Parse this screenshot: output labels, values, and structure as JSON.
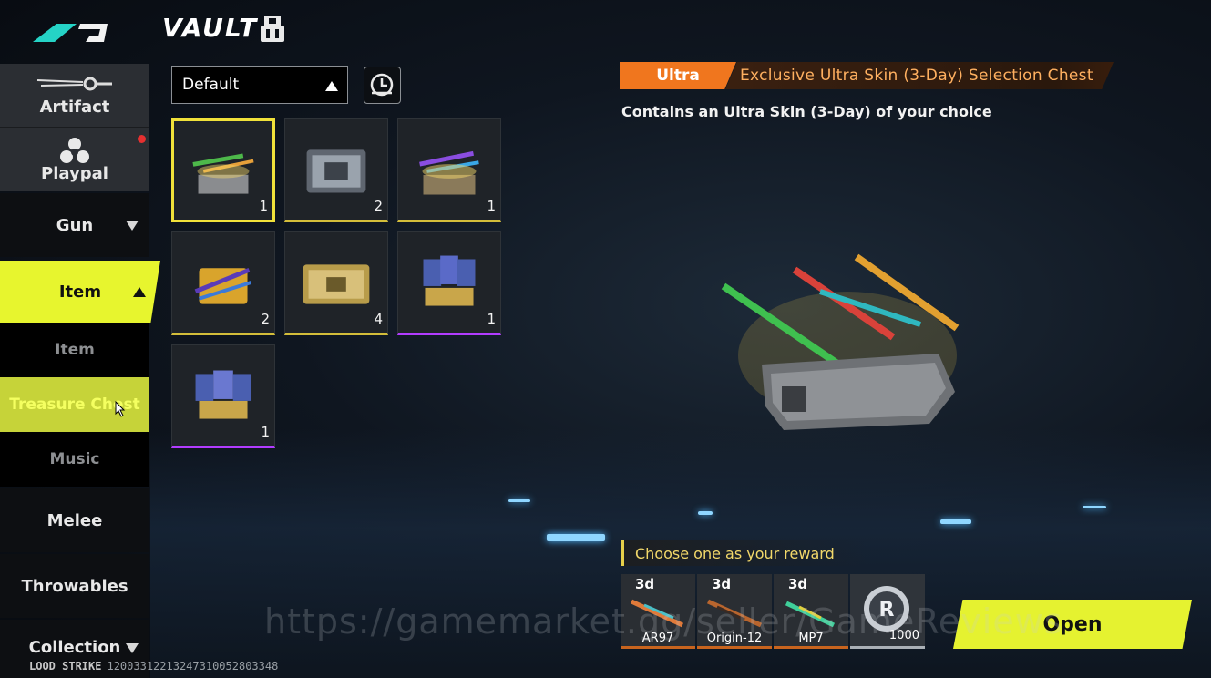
{
  "header": {
    "title": "VAULT",
    "icon": "vault-box-icon"
  },
  "sidebar": {
    "items": [
      {
        "label": "Artifact",
        "icon": "artifact-icon"
      },
      {
        "label": "Playpal",
        "icon": "playpal-icon",
        "notification": true
      },
      {
        "label": "Gun",
        "expanded": false
      },
      {
        "label": "Item",
        "expanded": true,
        "active": true
      },
      {
        "label": "Item"
      },
      {
        "label": "Treasure Chest",
        "selected": true
      },
      {
        "label": "Music"
      },
      {
        "label": "Melee"
      },
      {
        "label": "Throwables"
      },
      {
        "label": "Collection",
        "expanded": false
      }
    ]
  },
  "footer": {
    "game": "LOOD STRIKE",
    "uid": "12003312213247310052803348"
  },
  "filter": {
    "selected": "Default",
    "sort_icon": "sort-clock-icon"
  },
  "grid": {
    "cells": [
      {
        "qty": "1",
        "rarity": "gold",
        "selected": true,
        "icon": "weapon-chest-icon"
      },
      {
        "qty": "2",
        "rarity": "gold",
        "icon": "silver-crate-icon"
      },
      {
        "qty": "1",
        "rarity": "gold",
        "icon": "weapon-chest-icon"
      },
      {
        "qty": "2",
        "rarity": "gold",
        "icon": "gold-weapon-chest-icon"
      },
      {
        "qty": "4",
        "rarity": "gold",
        "icon": "gold-crate-icon"
      },
      {
        "qty": "1",
        "rarity": "purple",
        "icon": "character-card-chest-icon"
      },
      {
        "qty": "1",
        "rarity": "purple",
        "icon": "character-card-chest-icon"
      }
    ]
  },
  "detail": {
    "rarity": "Ultra",
    "title": "Exclusive Ultra Skin (3-Day) Selection Chest",
    "description": "Contains an Ultra Skin (3-Day) of your choice",
    "reward_prompt": "Choose one as your reward",
    "rewards": [
      {
        "days": "3d",
        "name": "AR97",
        "icon": "rifle-icon"
      },
      {
        "days": "3d",
        "name": "Origin-12",
        "icon": "shotgun-icon"
      },
      {
        "days": "3d",
        "name": "MP7",
        "icon": "smg-icon"
      },
      {
        "amount": "1000",
        "icon": "r-coin-icon"
      }
    ],
    "open_label": "Open",
    "colors": {
      "accent": "#e5f230",
      "ultra": "#f0761e",
      "gold": "#d3bd3a",
      "purple": "#b23cff"
    }
  },
  "watermark": "https://gamemarket.gg/seller/GameReviews"
}
